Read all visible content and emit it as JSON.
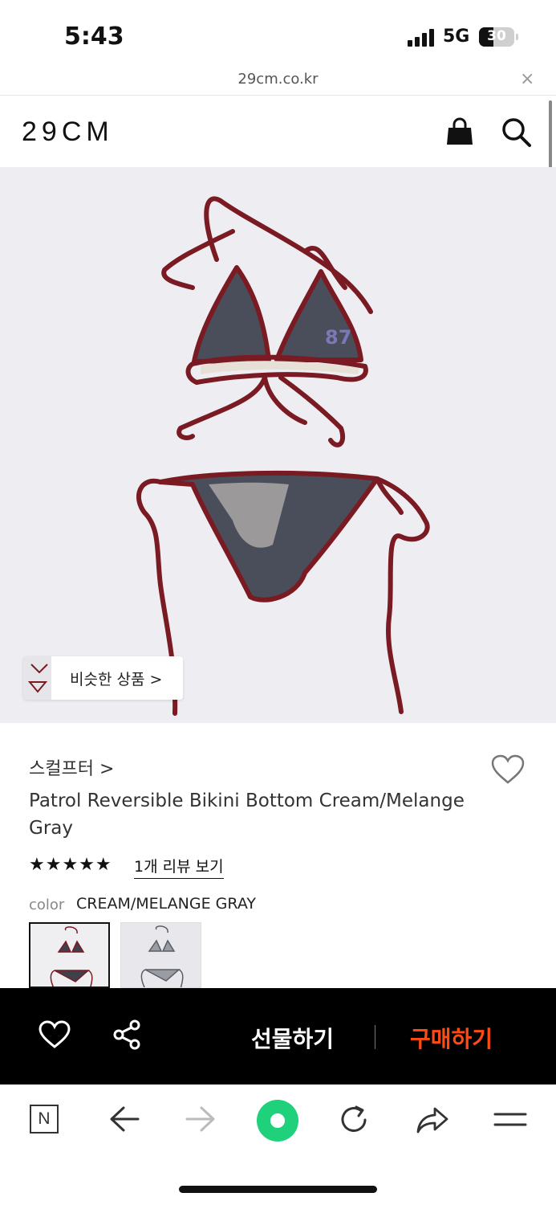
{
  "status_bar": {
    "time": "5:43",
    "network": "5G",
    "battery": "30"
  },
  "url_bar": {
    "url": "29cm.co.kr",
    "close": "×"
  },
  "header": {
    "logo": "29CM"
  },
  "product": {
    "similar_label": "비슷한 상품 >",
    "brand": "스컬프터 >",
    "title": "Patrol Reversible Bikini Bottom Cream/Melange Gray",
    "rating": 5,
    "stars": "★★★★★",
    "review_link": "1개 리뷰 보기",
    "color_label": "color",
    "color_value": "CREAM/MELANGE GRAY",
    "swatches": [
      "cream-melange-gray",
      "alt-color"
    ]
  },
  "purchase_bar": {
    "gift_label": "선물하기",
    "buy_label": "구매하기",
    "buy_color": "#ff4a12"
  },
  "browser_toolbar": {
    "n_label": "N"
  },
  "icons": [
    "bag-icon",
    "search-icon",
    "heart-icon",
    "share-icon",
    "back-arrow-icon",
    "forward-arrow-icon",
    "green-dot-icon",
    "reload-icon",
    "share-arrow-icon",
    "menu-icon"
  ]
}
